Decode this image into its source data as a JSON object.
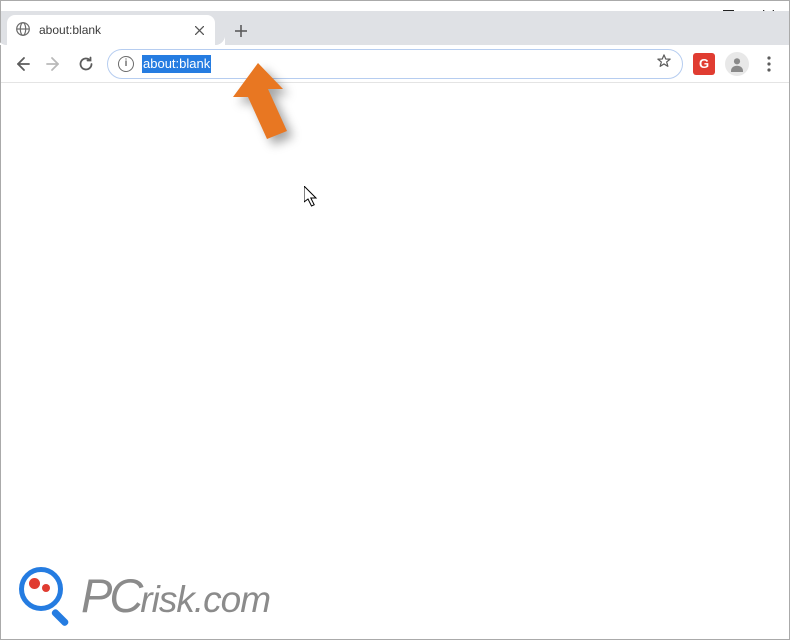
{
  "tab": {
    "title": "about:blank",
    "favicon": "globe-icon"
  },
  "addressbar": {
    "info_tooltip": "i",
    "url_selected": "about:blank"
  },
  "extension": {
    "label": "G"
  },
  "annotation": {
    "arrow_color": "#e87722"
  },
  "watermark": {
    "brand_pc": "PC",
    "brand_rest": "risk.com"
  }
}
